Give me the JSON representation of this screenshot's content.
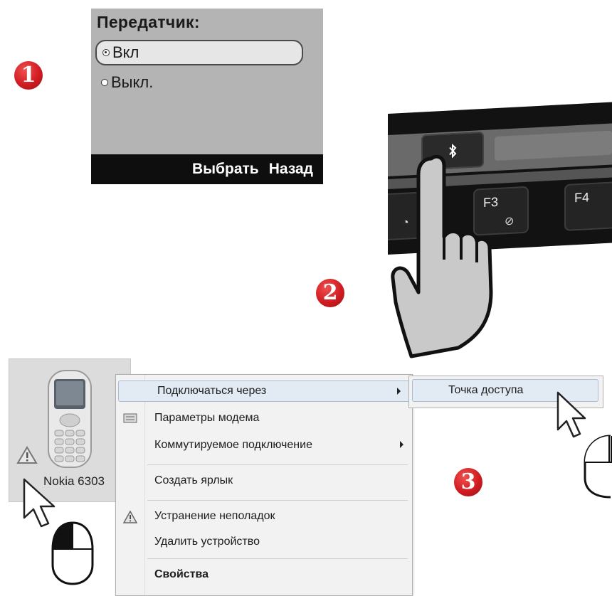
{
  "steps": {
    "one": "1",
    "two": "2",
    "three": "3"
  },
  "phone": {
    "title": "Передатчик:",
    "options": [
      {
        "label": "Вкл",
        "selected": true
      },
      {
        "label": "Выкл.",
        "selected": false
      }
    ],
    "softkeys": {
      "left": "Выбрать",
      "right": "Назад"
    }
  },
  "keyboard": {
    "bluetooth_key": "bluetooth-icon",
    "keys": [
      "F3",
      "F4"
    ]
  },
  "device": {
    "name": "Nokia 6303",
    "warning_icon": "warning-icon"
  },
  "context_menu": {
    "items": [
      {
        "label": "Подключаться через",
        "submenu": true
      },
      {
        "label": "Параметры модема",
        "icon": "modem-icon"
      },
      {
        "label": "Коммутируемое подключение",
        "submenu": true
      },
      {
        "label": "Создать ярлык"
      },
      {
        "label": "Устранение неполадок",
        "icon": "warning-icon"
      },
      {
        "label": "Удалить устройство"
      },
      {
        "label": "Свойства",
        "bold": true
      }
    ]
  },
  "submenu": {
    "items": [
      {
        "label": "Точка доступа"
      }
    ]
  },
  "colors": {
    "badge_red": "#d01c22",
    "menu_highlight": "#e2eaf4",
    "phone_screen": "#b4b4b4"
  }
}
